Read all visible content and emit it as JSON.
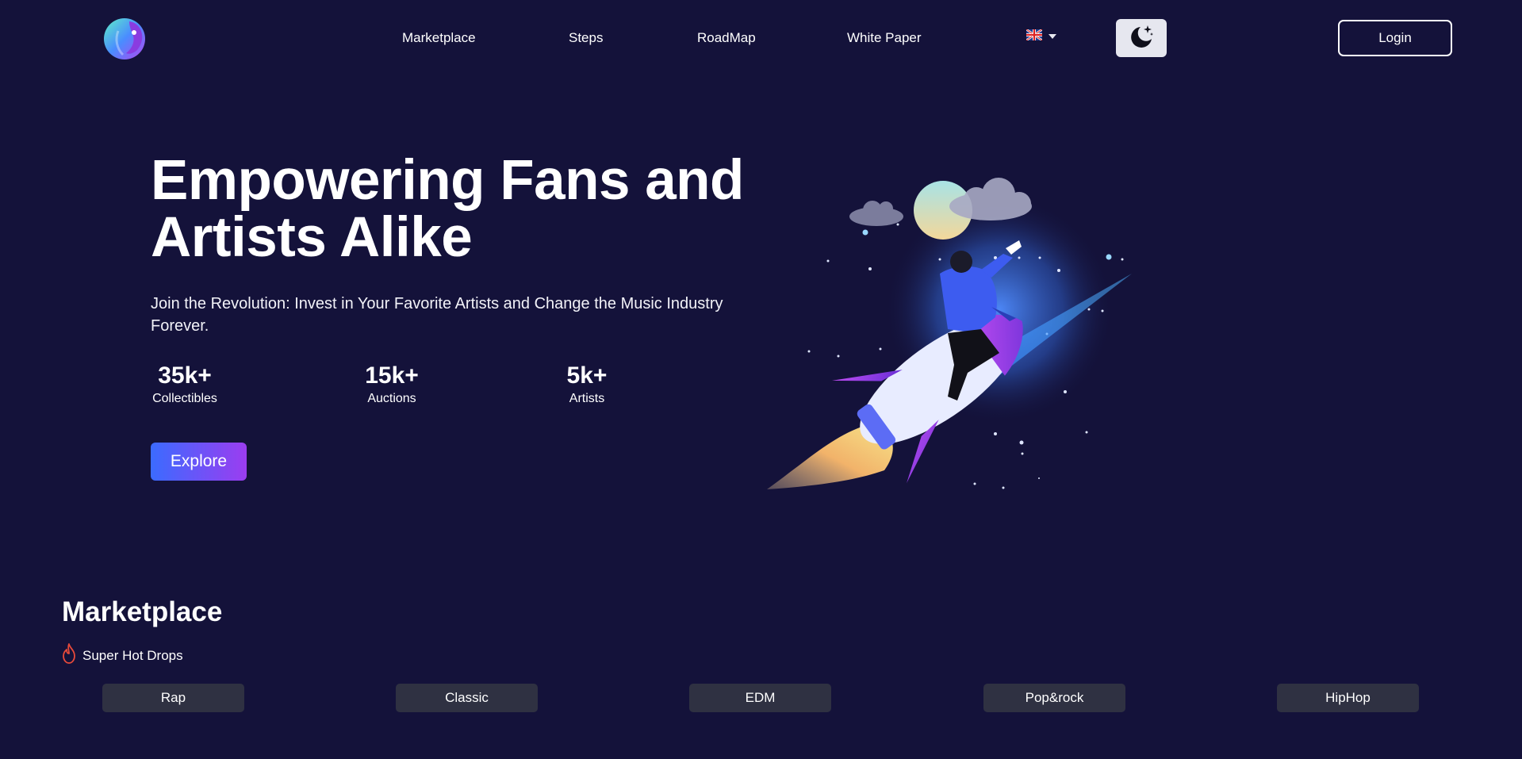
{
  "nav": {
    "logo": "brand-logo",
    "links": [
      "Marketplace",
      "Steps",
      "RoadMap",
      "White Paper"
    ],
    "language_icon": "uk-flag-icon",
    "theme_icon": "moon-stars-icon",
    "login_label": "Login"
  },
  "hero": {
    "title": "Empowering Fans and Artists Alike",
    "subtitle": "Join the Revolution: Invest in Your Favorite Artists and Change the Music Industry Forever.",
    "stats": [
      {
        "value": "35k+",
        "label": "Collectibles"
      },
      {
        "value": "15k+",
        "label": "Auctions"
      },
      {
        "value": "5k+",
        "label": "Artists"
      }
    ],
    "explore_label": "Explore",
    "illustration": "rocket-rider-illustration"
  },
  "marketplace": {
    "title": "Marketplace",
    "hot_icon": "flame-icon",
    "hot_label": "Super Hot Drops",
    "categories": [
      "Rap",
      "Classic",
      "EDM",
      "Pop&rock",
      "HipHop"
    ]
  },
  "colors": {
    "background": "#14123a",
    "accent_start": "#3b6bff",
    "accent_end": "#9b3df0",
    "category_bg": "#2f3142"
  }
}
